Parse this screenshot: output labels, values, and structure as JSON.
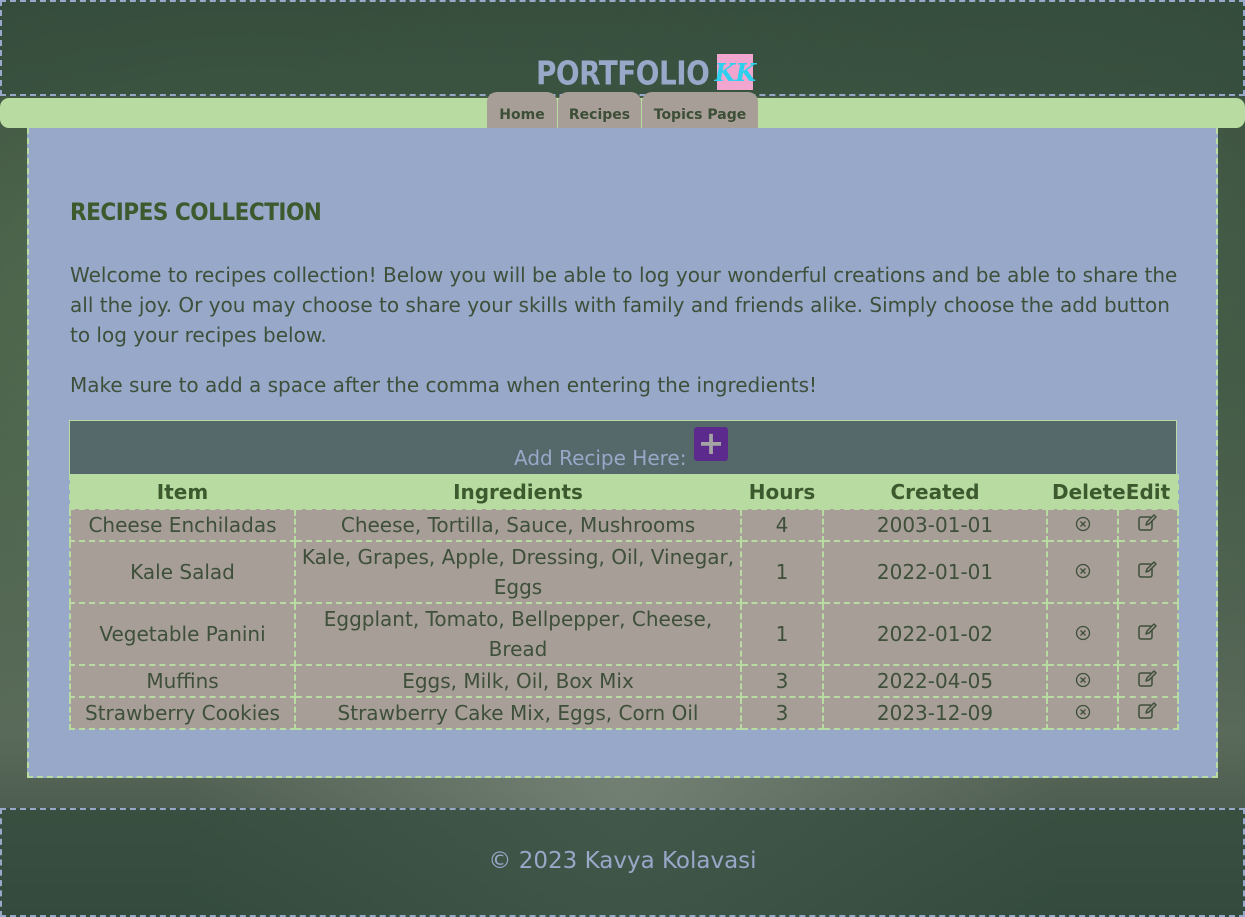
{
  "brand": {
    "text": "PORTFOLIO",
    "badge": "KK"
  },
  "nav": {
    "items": [
      "Home",
      "Recipes",
      "Topics Page"
    ]
  },
  "main": {
    "title": "Recipes Collection",
    "intro": "Welcome to recipes collection! Below you will be able to log your wonderful creations and be able to share the all the joy. Or you may choose to share your skills with family and friends alike. Simply choose the add button to log your recipes below.",
    "note": "Make sure to add a space after the comma when entering the ingredients!",
    "add_label": "Add Recipe Here:",
    "add_button": "+"
  },
  "table": {
    "headers": [
      "Item",
      "Ingredients",
      "Hours",
      "Created",
      "Delete",
      "Edit"
    ],
    "rows": [
      {
        "item": "Cheese Enchiladas",
        "ingredients": "Cheese, Tortilla, Sauce, Mushrooms",
        "hours": "4",
        "created": "2003-01-01"
      },
      {
        "item": "Kale Salad",
        "ingredients": "Kale, Grapes, Apple, Dressing, Oil, Vinegar, Eggs",
        "hours": "1",
        "created": "2022-01-01"
      },
      {
        "item": "Vegetable Panini",
        "ingredients": "Eggplant, Tomato, Bellpepper, Cheese, Bread",
        "hours": "1",
        "created": "2022-01-02"
      },
      {
        "item": "Muffins",
        "ingredients": "Eggs, Milk, Oil, Box Mix",
        "hours": "3",
        "created": "2022-04-05"
      },
      {
        "item": "Strawberry Cookies",
        "ingredients": "Strawberry Cake Mix, Eggs, Corn Oil",
        "hours": "3",
        "created": "2023-12-09"
      }
    ],
    "delete_icon": "circle-x-icon",
    "edit_icon": "pencil-square-icon"
  },
  "footer": {
    "text": "© 2023 Kavya Kolavasi"
  },
  "colors": {
    "accent_green": "#b8dba2",
    "panel_blue": "#97a8c9",
    "button_taupe": "#a69e97",
    "add_purple": "#5b2a8c",
    "add_bar": "#55696a"
  }
}
